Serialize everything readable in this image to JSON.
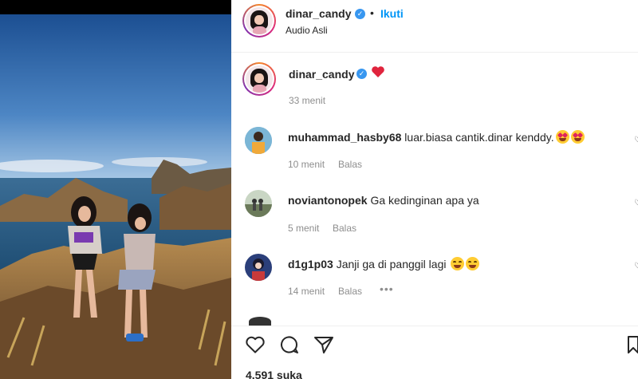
{
  "post": {
    "author": "dinar_candy",
    "follow_label": "Ikuti",
    "audio_label": "Audio Asli",
    "separator": "•",
    "caption_time": "33 menit",
    "likes_text": "4.591 suka"
  },
  "comments": [
    {
      "user": "muhammad_hasby68",
      "text": "luar.biasa cantik.dinar kenddy.",
      "time": "10 menit",
      "reply": "Balas"
    },
    {
      "user": "noviantonopek",
      "text": "Ga kedinginan apa ya",
      "time": "5 menit",
      "reply": "Balas"
    },
    {
      "user": "d1g1p03",
      "text": "Janji ga di panggil lagi",
      "time": "14 menit",
      "reply": "Balas"
    }
  ],
  "icons": [
    "verified-badge-icon",
    "heart-icon",
    "comment-icon",
    "share-icon",
    "bookmark-icon",
    "more-options-icon"
  ],
  "colors": {
    "accent": "#0095f6",
    "verified": "#3897f0",
    "heart": "#ed4956",
    "muted": "#8e8e8e"
  }
}
